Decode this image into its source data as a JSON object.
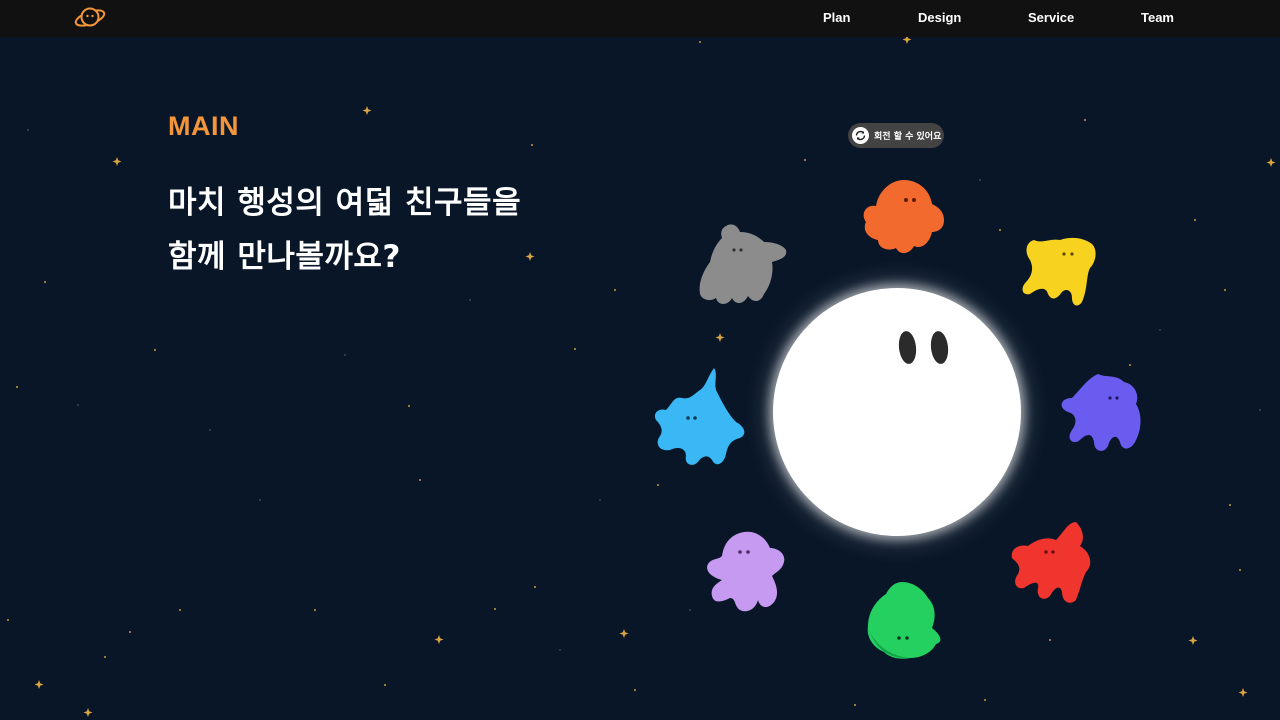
{
  "nav": {
    "logo_icon": "planet-face-logo",
    "items": [
      {
        "label": "Plan"
      },
      {
        "label": "Design"
      },
      {
        "label": "Service"
      },
      {
        "label": "Team"
      }
    ]
  },
  "hero": {
    "label": "MAIN",
    "title_lines": [
      "마치 행성의 여덟 친구들을",
      "함께 만나볼까요?"
    ]
  },
  "rotate_hint": {
    "text": "회전 할 수 있어요",
    "icon": "rotate-arrows-icon"
  },
  "colors": {
    "background": "#081628",
    "topbar": "#111111",
    "accent": "#f5953a",
    "planet": "#ffffff",
    "star": "#d9a441",
    "creatures": {
      "orange": "#f26a2e",
      "yellow": "#f7d21f",
      "violet": "#6b5cf0",
      "red": "#f0342e",
      "green": "#24d160",
      "lavender": "#c79af2",
      "blue": "#3ab7f5",
      "gray": "#8c8c8c"
    }
  }
}
